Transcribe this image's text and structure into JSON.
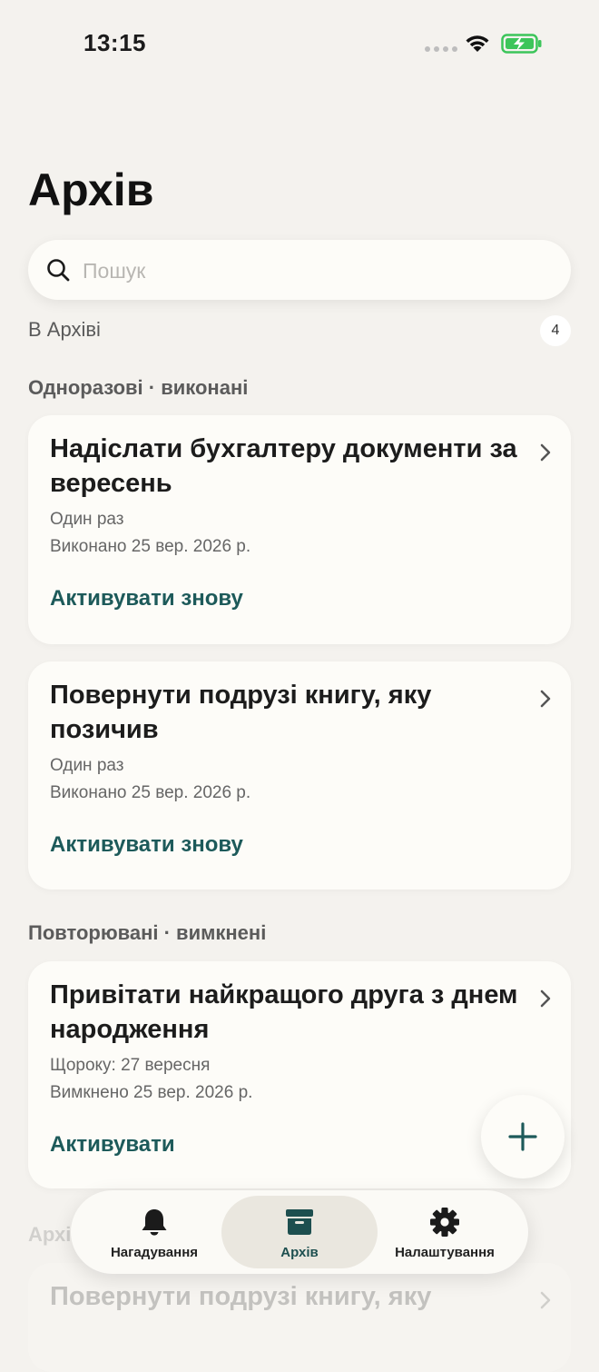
{
  "status_bar": {
    "time": "13:15"
  },
  "page": {
    "title": "Архів"
  },
  "search": {
    "placeholder": "Пошук"
  },
  "archive": {
    "label": "В Архіві",
    "count": "4"
  },
  "sections": [
    {
      "header": "Одноразові · виконані",
      "cards": [
        {
          "title": "Надіслати бухгалтеру документи за вересень",
          "schedule": "Один раз",
          "status": "Виконано 25 вер. 2026 р.",
          "action": "Активувати знову"
        },
        {
          "title": "Повернути подрузі книгу, яку позичив",
          "schedule": "Один раз",
          "status": "Виконано 25 вер. 2026 р.",
          "action": "Активувати знову"
        }
      ]
    },
    {
      "header": "Повторювані · вимкнені",
      "cards": [
        {
          "title": "Привітати найкращого друга з днем народження",
          "schedule": "Щороку: 27 вересня",
          "status": "Вимкнено 25 вер. 2026 р.",
          "action": "Активувати"
        }
      ]
    },
    {
      "header": "Архівовані · ручно",
      "cards": [
        {
          "title": "Повернути подрузі книгу, яку"
        }
      ]
    }
  ],
  "tab_bar": {
    "tabs": [
      {
        "label": "Нагадування",
        "icon": "bell-icon",
        "active": false
      },
      {
        "label": "Архів",
        "icon": "archive-box-icon",
        "active": true
      },
      {
        "label": "Налаштування",
        "icon": "gear-icon",
        "active": false
      }
    ]
  },
  "colors": {
    "background": "#f4f2ee",
    "card": "#fdfcf8",
    "accent": "#1d5a5a",
    "battery": "#3cc55a"
  }
}
